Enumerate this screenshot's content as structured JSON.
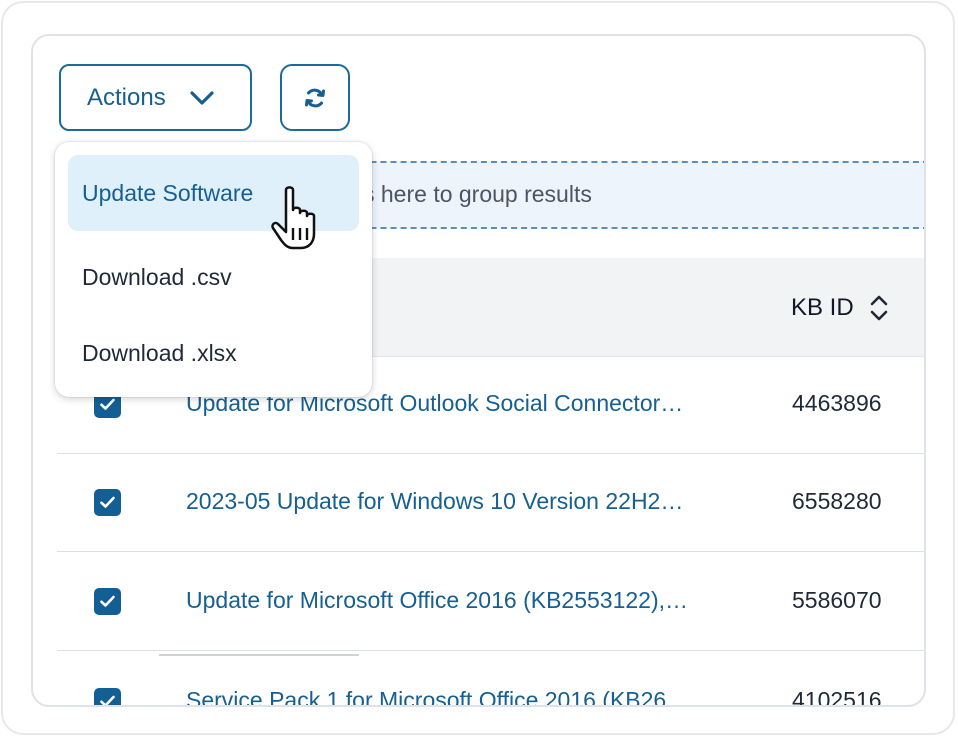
{
  "toolbar": {
    "actions_label": "Actions",
    "actions_icon": "chevron-down-icon",
    "refresh_icon": "refresh-icon"
  },
  "group_bar": {
    "text": "s here to group results"
  },
  "table": {
    "kb_header": "KB ID",
    "sort_icon": "sort-icon",
    "rows": [
      {
        "title": "Update for Microsoft Outlook Social Connector…",
        "kb": "4463896",
        "checked": true
      },
      {
        "title": "2023-05 Update for Windows 10 Version 22H2…",
        "kb": "6558280",
        "checked": true
      },
      {
        "title": "Update for Microsoft Office 2016 (KB2553122),…",
        "kb": "5586070",
        "checked": true
      },
      {
        "title": "Service Pack 1 for Microsoft Office 2016 (KB26…",
        "kb": "4102516",
        "checked": true
      }
    ]
  },
  "dropdown": {
    "items": [
      {
        "label": "Update Software",
        "active": true
      },
      {
        "label": "Download .csv",
        "active": false
      },
      {
        "label": "Download .xlsx",
        "active": false
      }
    ]
  },
  "colors": {
    "accent": "#155f92",
    "checkbox": "#135f94",
    "group_bar_bg": "#edf4fb",
    "menu_active_bg": "#dff0fb"
  }
}
